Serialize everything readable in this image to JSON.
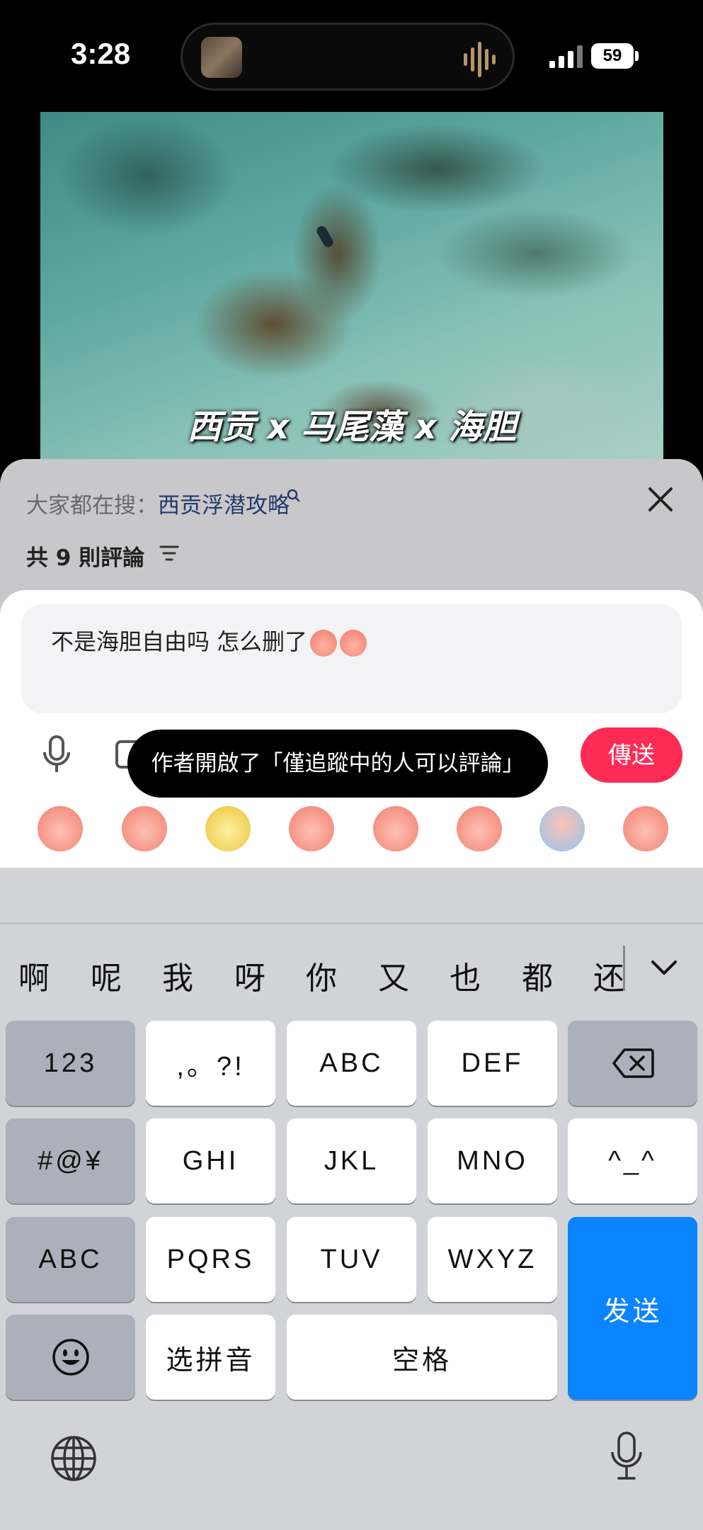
{
  "status_bar": {
    "time": "3:28",
    "battery": "59"
  },
  "video": {
    "caption": "西贡 x 马尾藻 x 海胆"
  },
  "comments": {
    "search_prefix": "大家都在搜：",
    "search_term": "西贡浮潜攻略",
    "count_label": "共 9 則評論"
  },
  "composer": {
    "input_value": "不是海胆自由吗 怎么删了",
    "toast": "作者開啟了「僅追蹤中的人可以評論」",
    "send_label": "傳送"
  },
  "emoji_row": [
    "peach-blush",
    "peach-shy",
    "yellow-dog",
    "peach-laugh-cry",
    "peach-pray",
    "peach-think",
    "peach-crying-pool",
    "peach-kiss"
  ],
  "keyboard": {
    "candidates": [
      "啊",
      "呢",
      "我",
      "呀",
      "你",
      "又",
      "也",
      "都",
      "还"
    ],
    "keys": {
      "num": "123",
      "punct": ",。?!",
      "abc_letters": "ABC",
      "def": "DEF",
      "symbols": "#@¥",
      "ghi": "GHI",
      "jkl": "JKL",
      "mno": "MNO",
      "face": "^_^",
      "abc_mode": "ABC",
      "pqrs": "PQRS",
      "tuv": "TUV",
      "wxyz": "WXYZ",
      "send": "发送",
      "pinyin": "选拼音",
      "space": "空格"
    }
  },
  "colors": {
    "send_button": "#fe2c55",
    "keyboard_send": "#0a84ff",
    "search_link": "#243a6a"
  }
}
